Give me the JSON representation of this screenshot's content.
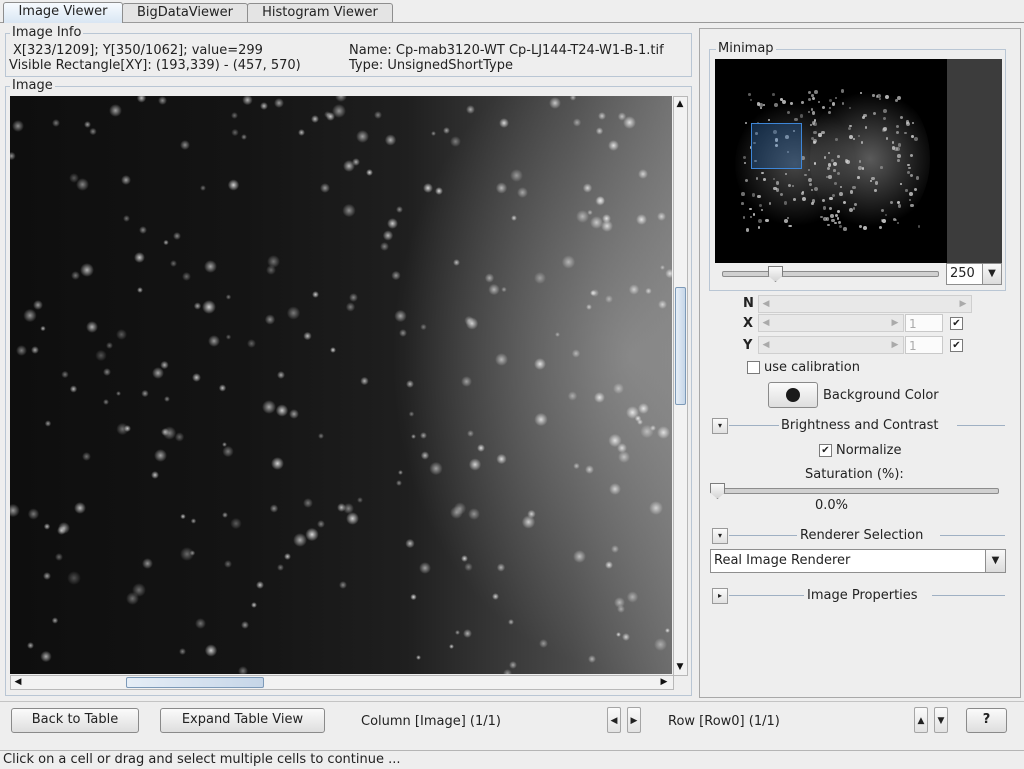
{
  "tabs": [
    {
      "label": "Image Viewer",
      "active": true
    },
    {
      "label": "BigDataViewer",
      "active": false
    },
    {
      "label": "Histogram Viewer",
      "active": false
    }
  ],
  "image_info": {
    "title": "Image Info",
    "coords": "X[323/1209]; Y[350/1062]; value=299",
    "visible_rect": "Visible Rectangle[XY]: (193,339) - (457, 570)",
    "name": "Name: Cp-mab3120-WT Cp-LJ144-T24-W1-B-1.tif",
    "type": "Type: UnsignedShortType"
  },
  "image_panel": {
    "title": "Image"
  },
  "minimap": {
    "title": "Minimap",
    "zoom_value": "250"
  },
  "dimensions": {
    "n_label": "N",
    "x_label": "X",
    "y_label": "Y",
    "x_value": "1",
    "y_value": "1",
    "x_checked": true,
    "y_checked": true
  },
  "calibration": {
    "label": "use calibration",
    "checked": false
  },
  "background_color": {
    "label": "Background Color",
    "color": "#1a1a1a"
  },
  "brightness_contrast": {
    "title": "Brightness and Contrast",
    "normalize_label": "Normalize",
    "normalize_checked": true,
    "saturation_label": "Saturation (%):",
    "saturation_value": "0.0%"
  },
  "renderer": {
    "title": "Renderer Selection",
    "selected": "Real Image Renderer"
  },
  "image_properties": {
    "title": "Image Properties"
  },
  "bottom_bar": {
    "back_button": "Back to Table",
    "expand_button": "Expand Table View",
    "column_label": "Column [Image] (1/1)",
    "row_label": "Row [Row0] (1/1)",
    "help_button": "?"
  },
  "status_text": "Click on a cell or drag and select multiple cells to continue ...",
  "colors": {
    "accent": "#7d9ab8",
    "minimap_selection": "#2f6db5"
  }
}
